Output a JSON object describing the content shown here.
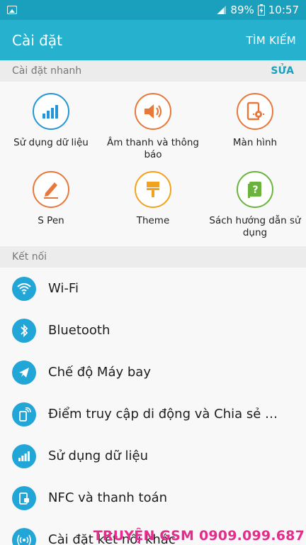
{
  "status": {
    "battery": "89%",
    "time": "10:57"
  },
  "appbar": {
    "title": "Cài đặt",
    "search": "TÌM KIẾM"
  },
  "quick": {
    "header": "Cài đặt nhanh",
    "edit": "SỬA",
    "items": [
      {
        "label": "Sử dụng dữ liệu",
        "icon": "data-usage-icon",
        "color": "#2496d6"
      },
      {
        "label": "Âm thanh và thông báo",
        "icon": "speaker-icon",
        "color": "#e8783a"
      },
      {
        "label": "Màn hình",
        "icon": "display-settings-icon",
        "color": "#e8783a"
      },
      {
        "label": "S Pen",
        "icon": "pen-icon",
        "color": "#e8783a"
      },
      {
        "label": "Theme",
        "icon": "paintbrush-icon",
        "color": "#f3a21d"
      },
      {
        "label": "Sách hướng dẫn sử dụng",
        "icon": "help-book-icon",
        "color": "#6ab43e"
      }
    ]
  },
  "connections": {
    "header": "Kết nối",
    "items": [
      {
        "label": "Wi-Fi",
        "icon": "wifi-icon"
      },
      {
        "label": "Bluetooth",
        "icon": "bluetooth-icon"
      },
      {
        "label": "Chế độ Máy bay",
        "icon": "airplane-icon"
      },
      {
        "label": "Điểm truy cập di động và Chia sẻ kết n..",
        "icon": "hotspot-icon"
      },
      {
        "label": "Sử dụng dữ liệu",
        "icon": "data-usage-icon"
      },
      {
        "label": "NFC và thanh toán",
        "icon": "nfc-icon"
      },
      {
        "label": "Cài đặt kết nối khác",
        "icon": "more-connections-icon"
      }
    ]
  },
  "watermark": "TRUYỆN GSM 0909.099.687",
  "colors": {
    "statusbar": "#1aa0bd",
    "appbar": "#26b2cf",
    "accent": "#22a6d8"
  }
}
